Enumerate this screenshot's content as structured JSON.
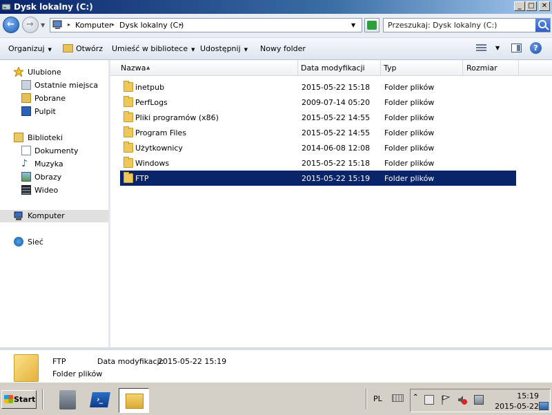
{
  "window": {
    "title": "Dysk lokalny (C:)",
    "controls": [
      "_",
      "□",
      "✕"
    ]
  },
  "address": {
    "crumbs": [
      "Komputer",
      "Dysk lokalny (C:)"
    ],
    "search_placeholder": "Przeszukaj: Dysk lokalny (C:)"
  },
  "toolbar": {
    "organize": "Organizuj",
    "open": "Otwórz",
    "include": "Umieść w bibliotece",
    "share": "Udostępnij",
    "new_folder": "Nowy folder",
    "help": "?"
  },
  "nav": {
    "favorites": "Ulubione",
    "recent": "Ostatnie miejsca",
    "downloads": "Pobrane",
    "desktop": "Pulpit",
    "libraries": "Biblioteki",
    "documents": "Dokumenty",
    "music": "Muzyka",
    "pictures": "Obrazy",
    "video": "Wideo",
    "computer": "Komputer",
    "network": "Sieć"
  },
  "columns": {
    "name": "Nazwa",
    "date": "Data modyfikacji",
    "type": "Typ",
    "size": "Rozmiar"
  },
  "files": [
    {
      "name": "inetpub",
      "date": "2015-05-22 15:18",
      "type": "Folder plików"
    },
    {
      "name": "PerfLogs",
      "date": "2009-07-14 05:20",
      "type": "Folder plików"
    },
    {
      "name": "Pliki programów (x86)",
      "date": "2015-05-22 14:55",
      "type": "Folder plików"
    },
    {
      "name": "Program Files",
      "date": "2015-05-22 14:55",
      "type": "Folder plików"
    },
    {
      "name": "Użytkownicy",
      "date": "2014-06-08 12:08",
      "type": "Folder plików"
    },
    {
      "name": "Windows",
      "date": "2015-05-22 15:18",
      "type": "Folder plików"
    },
    {
      "name": "FTP",
      "date": "2015-05-22 15:19",
      "type": "Folder plików",
      "selected": true
    }
  ],
  "details": {
    "name": "FTP",
    "type": "Folder plików",
    "date_label": "Data modyfikacji:",
    "date_value": "2015-05-22 15:19"
  },
  "taskbar": {
    "start": "Start",
    "language": "PL",
    "ps_glyph": "›_",
    "time": "15:19",
    "date": "2015-05-22"
  },
  "colors": {
    "selection": "#0a246a",
    "titlebar": "#0a246a",
    "taskbar": "#d4d0c8"
  }
}
